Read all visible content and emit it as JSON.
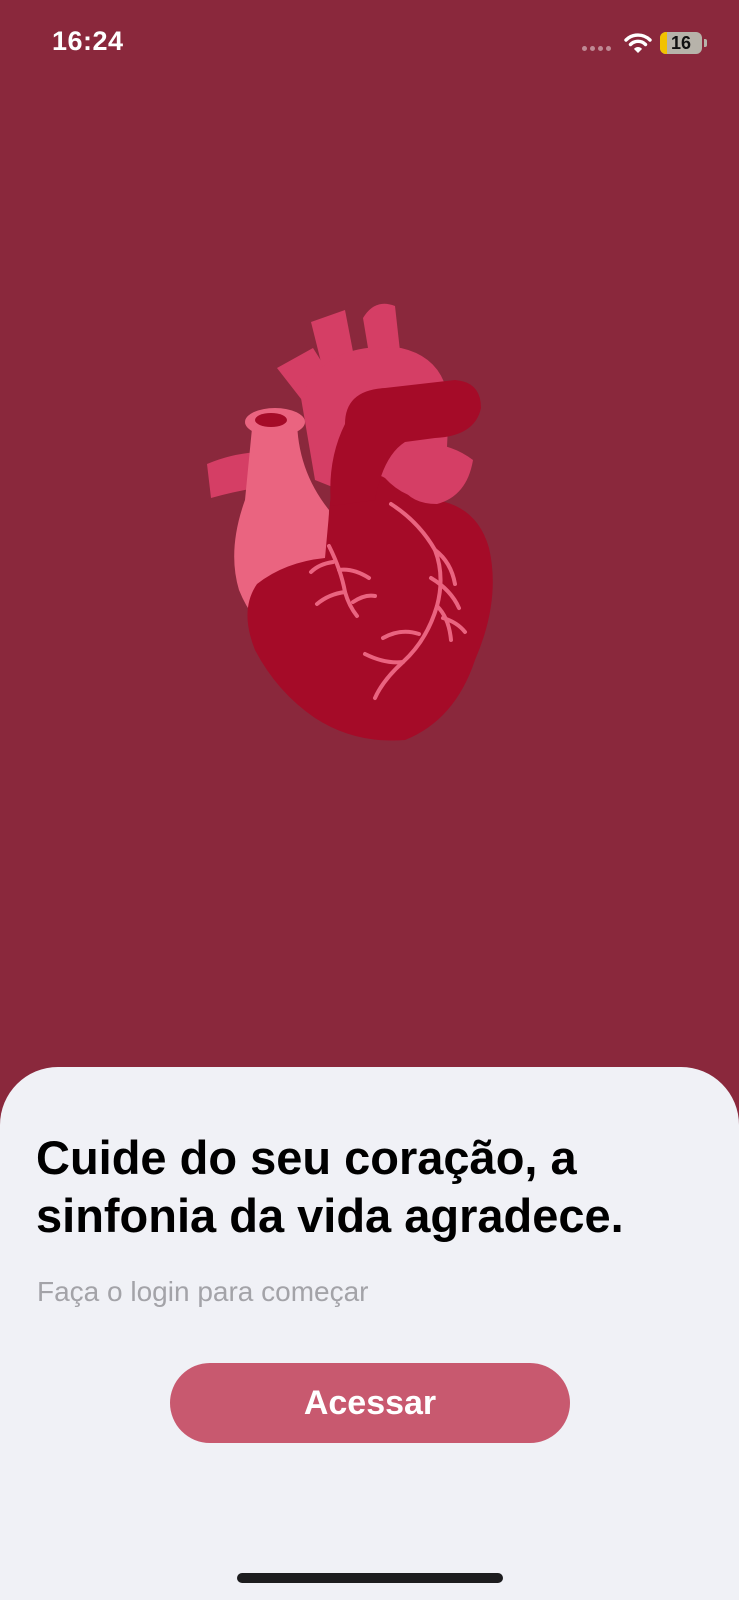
{
  "status_bar": {
    "time": "16:24",
    "battery_level": "16",
    "battery_fraction": 0.16,
    "icons": [
      "signal-dots-icon",
      "wifi-icon",
      "battery-icon"
    ]
  },
  "hero": {
    "image": "anatomical-heart-illustration"
  },
  "onboarding": {
    "headline": "Cuide do seu coração, a sinfonia da vida agradece.",
    "subtitle": "Faça o login para começar",
    "cta_label": "Acessar"
  },
  "colors": {
    "background": "#8a283c",
    "sheet": "#f0f1f6",
    "button": "#c8596f",
    "heart_dark": "#a50b28",
    "heart_mid": "#d53e65",
    "heart_light": "#ea6480",
    "battery_fill": "#f2c200"
  }
}
